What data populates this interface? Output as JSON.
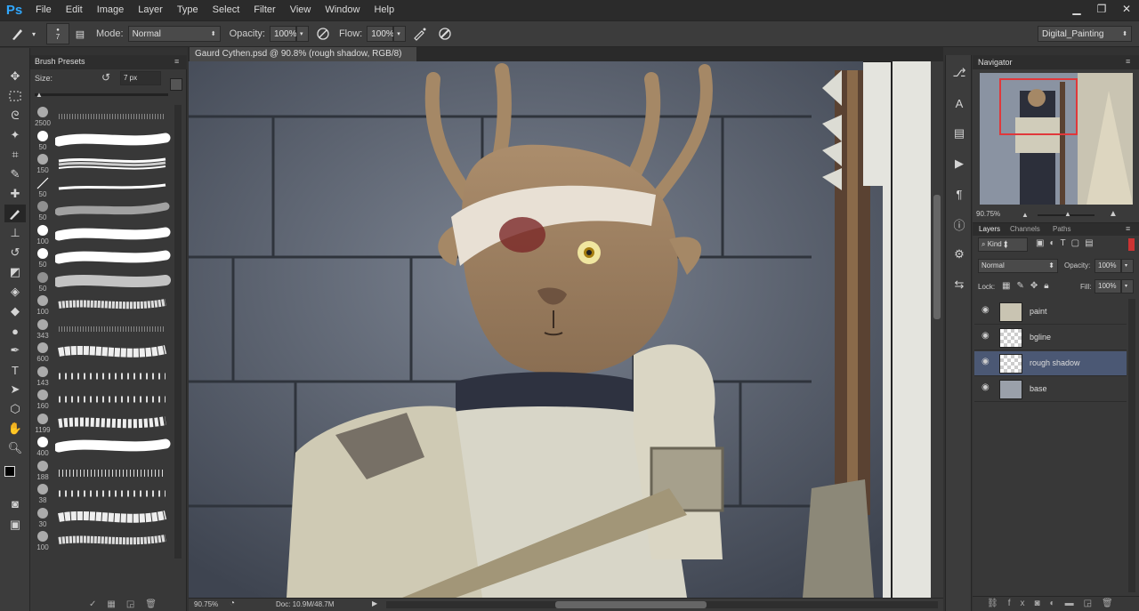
{
  "app": {
    "logo": "Ps"
  },
  "menu": [
    "File",
    "Edit",
    "Image",
    "Layer",
    "Type",
    "Select",
    "Filter",
    "View",
    "Window",
    "Help"
  ],
  "window_controls": {
    "minimize": "▁",
    "restore": "❐",
    "close": "✕"
  },
  "options_bar": {
    "brush_size": "7",
    "mode_label": "Mode:",
    "mode_value": "Normal",
    "opacity_label": "Opacity:",
    "opacity_value": "100%",
    "flow_label": "Flow:",
    "flow_value": "100%",
    "workspace": "Digital_Painting"
  },
  "brush_presets": {
    "tab": "Brush Presets",
    "size_label": "Size:",
    "size_value": "7 px",
    "brushes": [
      {
        "num": "2500",
        "type": "spray"
      },
      {
        "num": "50",
        "type": "hard-white"
      },
      {
        "num": "150",
        "type": "bristle"
      },
      {
        "num": "50",
        "type": "thin"
      },
      {
        "num": "50",
        "type": "soft-grey"
      },
      {
        "num": "100",
        "type": "hard-white"
      },
      {
        "num": "50",
        "type": "hard-white"
      },
      {
        "num": "50",
        "type": "soft-white"
      },
      {
        "num": "100",
        "type": "chalk"
      },
      {
        "num": "343",
        "type": "spray"
      },
      {
        "num": "600",
        "type": "rough"
      },
      {
        "num": "143",
        "type": "splatter"
      },
      {
        "num": "160",
        "type": "splatter"
      },
      {
        "num": "1199",
        "type": "rope"
      },
      {
        "num": "400",
        "type": "hard-white"
      },
      {
        "num": "188",
        "type": "grass"
      },
      {
        "num": "38",
        "type": "splatter"
      },
      {
        "num": "30",
        "type": "rough"
      },
      {
        "num": "100",
        "type": "chalk"
      }
    ]
  },
  "document": {
    "tab": "Gaurd Cythen.psd @ 90.8% (rough shadow, RGB/8) *",
    "zoom": "90.75%",
    "doc_size": "Doc: 10.9M/48.7M"
  },
  "navigator": {
    "tab": "Navigator",
    "zoom": "90.75%"
  },
  "layers_panel": {
    "tabs": [
      "Layers",
      "Channels",
      "Paths"
    ],
    "kind_label": "Kind",
    "blend_mode": "Normal",
    "opacity_label": "Opacity:",
    "opacity_value": "100%",
    "lock_label": "Lock:",
    "fill_label": "Fill:",
    "fill_value": "100%",
    "layers": [
      {
        "name": "paint",
        "selected": false
      },
      {
        "name": "bgline",
        "selected": false
      },
      {
        "name": "rough shadow",
        "selected": true
      },
      {
        "name": "base",
        "selected": false
      }
    ],
    "footer_icons": [
      "link-icon",
      "fx-icon",
      "mask-icon",
      "adjustment-icon",
      "group-icon",
      "new-layer-icon",
      "trash-icon"
    ]
  },
  "colors": {
    "accent": "#31a8ff",
    "selected_layer": "#4b5874",
    "nav_box": "#e0383b"
  }
}
